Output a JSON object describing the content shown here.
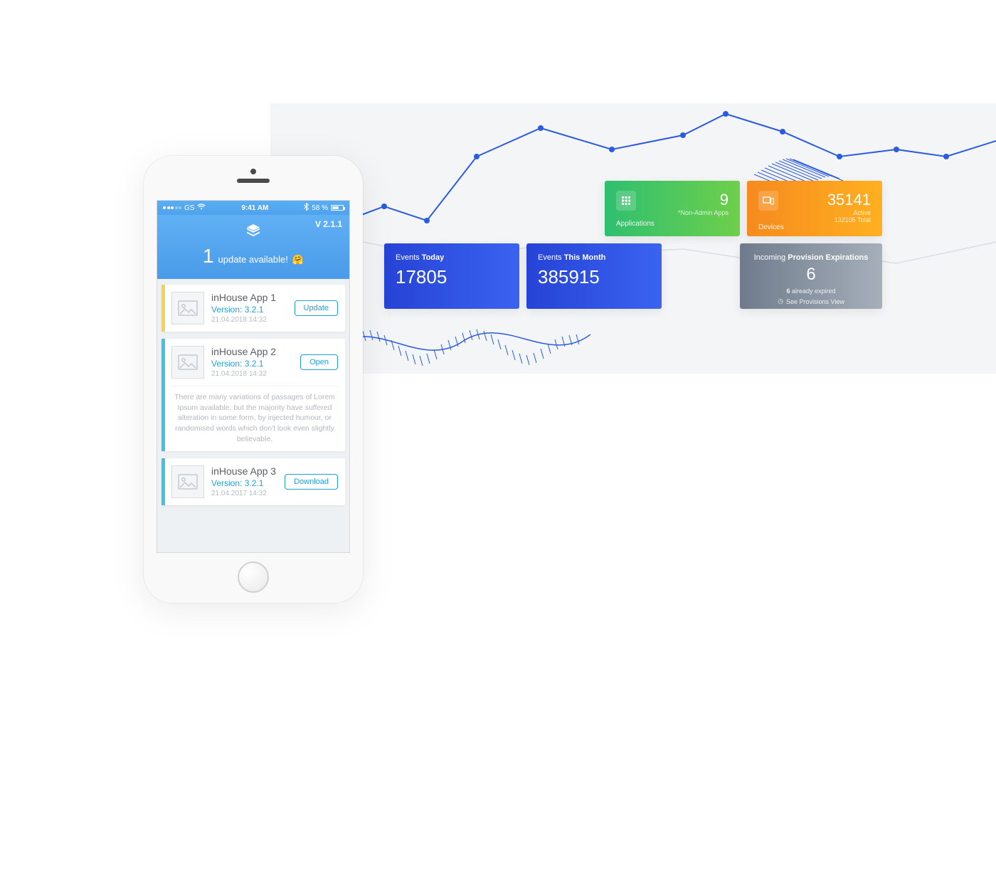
{
  "phone": {
    "status": {
      "carrier": "GS",
      "time": "9:41 AM",
      "battery_pct": "58 %"
    },
    "app_version": "V 2.1.1",
    "update_count": "1",
    "update_text": "update available!",
    "update_emoji": "🤗",
    "apps": [
      {
        "name": "inHouse App 1",
        "version": "Version: 3.2.1",
        "date": "21.04.2018 14:32",
        "action": "Update",
        "stripe": "yellow",
        "desc": ""
      },
      {
        "name": "inHouse App 2",
        "version": "Version: 3.2.1",
        "date": "21.04.2018 14:32",
        "action": "Open",
        "stripe": "cyan",
        "desc": "There are many variations of passages of Lorem Ipsum available, but the majority have suffered alteration in some form, by injected humour, or randomised words which don't look even slightly believable."
      },
      {
        "name": "inHouse App 3",
        "version": "Version: 3.2.1",
        "date": "21.04.2017 14:32",
        "action": "Download",
        "stripe": "cyan",
        "desc": ""
      }
    ]
  },
  "dashboard": {
    "applications": {
      "label": "Applications",
      "value": "9",
      "sub": "*Non-Admin Apps"
    },
    "devices": {
      "label": "Devices",
      "value": "35141",
      "sub_status": "Active",
      "sub_total": "132105 Total"
    },
    "events_today": {
      "label_prefix": "Events ",
      "label_bold": "Today",
      "value": "17805"
    },
    "events_month": {
      "label_prefix": "Events ",
      "label_bold": "This Month",
      "value": "385915"
    },
    "provisions": {
      "title_prefix": "Incoming ",
      "title_bold": "Provision Expirations",
      "value": "6",
      "expired_count": "6",
      "expired_suffix": " already expired",
      "link": "See Provisions View"
    }
  }
}
